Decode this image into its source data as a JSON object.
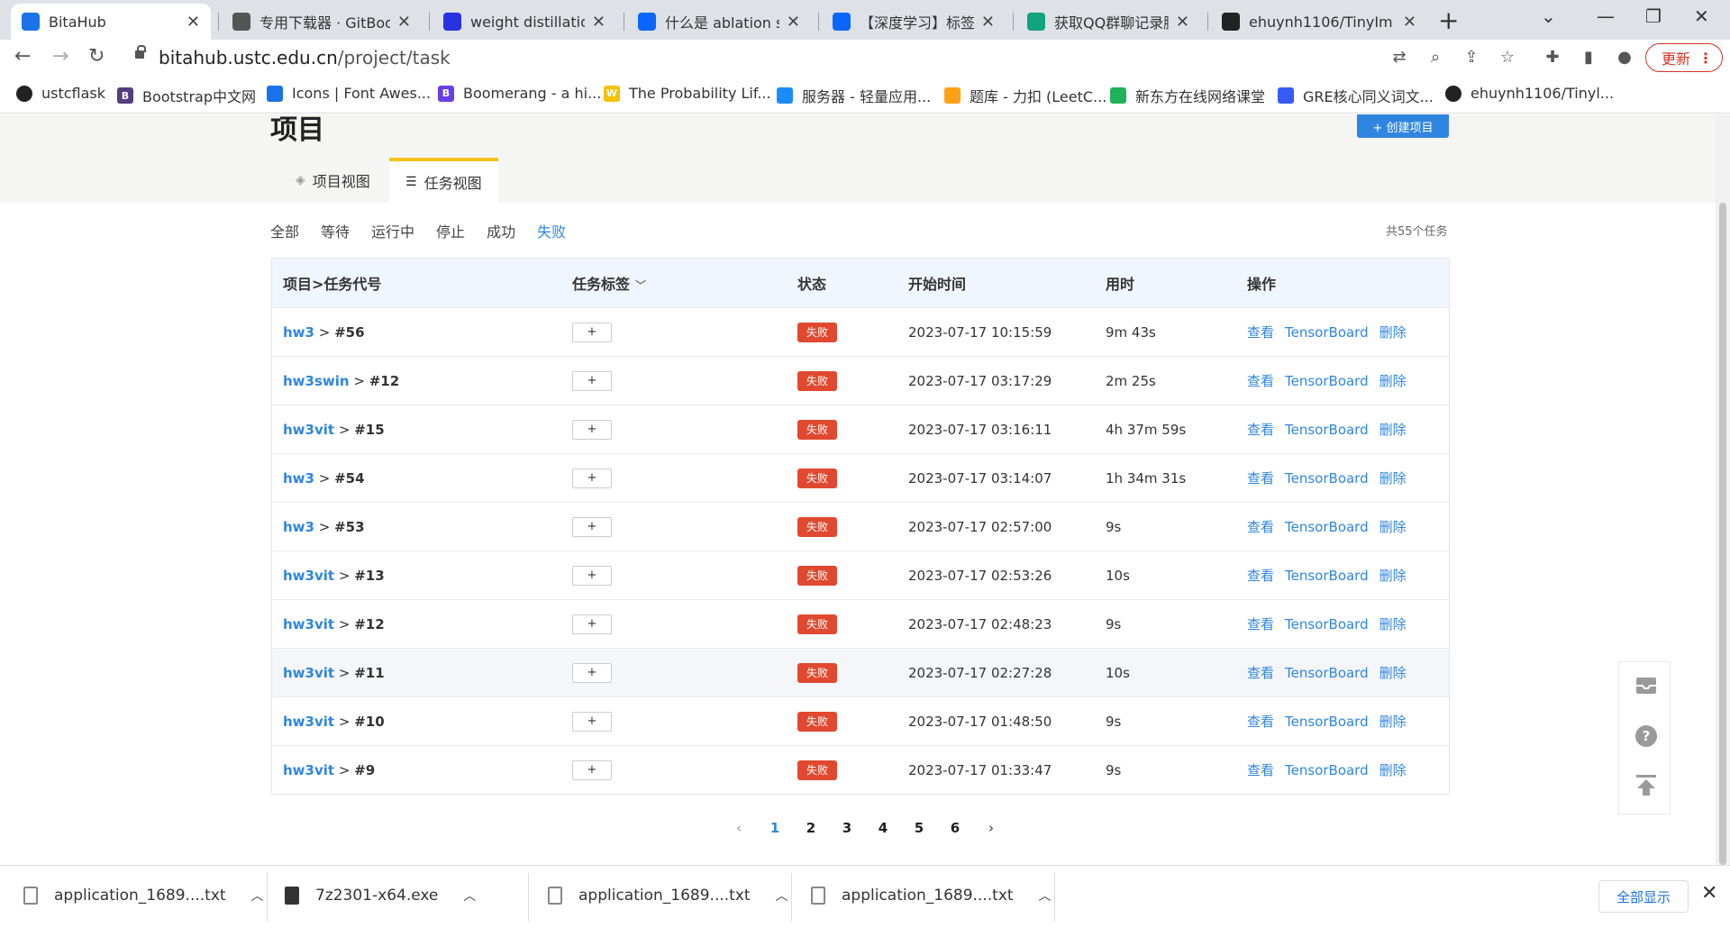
{
  "browser": {
    "tabs": [
      {
        "title": "BitaHub",
        "icon": "bitahub-icon",
        "color": "#1a73e8"
      },
      {
        "title": "专用下载器 · GitBook",
        "icon": "book-icon",
        "color": "#555555"
      },
      {
        "title": "weight distillation_",
        "icon": "baidu-paw-icon",
        "color": "#2932e1"
      },
      {
        "title": "什么是 ablation stud",
        "icon": "zhihu-icon",
        "color": "#0a66ff"
      },
      {
        "title": "【深度学习】标签平",
        "icon": "zhihu-icon",
        "color": "#0a66ff"
      },
      {
        "title": "获取QQ群聊记录脚本",
        "icon": "chatgpt-icon",
        "color": "#10a37f"
      },
      {
        "title": "ehuynh1106/TinyIm",
        "icon": "github-icon",
        "color": "#222222"
      }
    ],
    "url_host": "bitahub.ustc.edu.cn",
    "url_path": "/project/task",
    "update_label": "更新",
    "bookmarks": [
      {
        "title": "ustcflask",
        "icon": "github-icon",
        "color": "#222222",
        "glyph": ""
      },
      {
        "title": "Bootstrap中文网",
        "icon": "bootstrap-icon",
        "color": "#563d7c",
        "glyph": "B"
      },
      {
        "title": "Icons | Font Awes...",
        "icon": "flag-icon",
        "color": "#1a73e8",
        "glyph": ""
      },
      {
        "title": "Boomerang - a hi...",
        "icon": "boomerang-icon",
        "color": "#6a3de8",
        "glyph": "B"
      },
      {
        "title": "The Probability Lif...",
        "icon": "w-icon",
        "color": "#f2c200",
        "glyph": "W"
      },
      {
        "title": "服务器 - 轻量应用...",
        "icon": "cloud-icon",
        "color": "#1a8cff",
        "glyph": ""
      },
      {
        "title": "题库 - 力扣 (LeetC...",
        "icon": "leetcode-icon",
        "color": "#ffa116",
        "glyph": ""
      },
      {
        "title": "新东方在线网络课堂",
        "icon": "koolearn-icon",
        "color": "#1fb25a",
        "glyph": ""
      },
      {
        "title": "GRE核心同义词文...",
        "icon": "search-q-icon",
        "color": "#3a5af4",
        "glyph": ""
      },
      {
        "title": "ehuynh1106/Tinyl...",
        "icon": "github-icon",
        "color": "#222222",
        "glyph": ""
      }
    ]
  },
  "page": {
    "title": "项目",
    "create_label": "+ 创建项目",
    "view_tabs": [
      {
        "label": "项目视图"
      },
      {
        "label": "任务视图"
      }
    ],
    "filters": [
      "全部",
      "等待",
      "运行中",
      "停止",
      "成功",
      "失败"
    ],
    "active_filter": "失败",
    "total_label": "共55个任务"
  },
  "table": {
    "headers": {
      "task": "项目>任务代号",
      "tags": "任务标签",
      "status": "状态",
      "start": "开始时间",
      "duration": "用时",
      "ops": "操作"
    },
    "plus_label": "+",
    "op_labels": {
      "view": "查看",
      "tensorboard": "TensorBoard",
      "delete": "删除"
    },
    "status_colors": {
      "failed": "#e0492f"
    },
    "rows": [
      {
        "project": "hw3",
        "sep": " > ",
        "id": "#56",
        "status": "失败",
        "start": "2023-07-17 10:15:59",
        "duration": "9m 43s"
      },
      {
        "project": "hw3swin",
        "sep": " > ",
        "id": "#12",
        "status": "失败",
        "start": "2023-07-17 03:17:29",
        "duration": "2m 25s"
      },
      {
        "project": "hw3vit",
        "sep": " > ",
        "id": "#15",
        "status": "失败",
        "start": "2023-07-17 03:16:11",
        "duration": "4h 37m 59s"
      },
      {
        "project": "hw3",
        "sep": " > ",
        "id": "#54",
        "status": "失败",
        "start": "2023-07-17 03:14:07",
        "duration": "1h 34m 31s"
      },
      {
        "project": "hw3",
        "sep": " > ",
        "id": "#53",
        "status": "失败",
        "start": "2023-07-17 02:57:00",
        "duration": "9s"
      },
      {
        "project": "hw3vit",
        "sep": " > ",
        "id": "#13",
        "status": "失败",
        "start": "2023-07-17 02:53:26",
        "duration": "10s"
      },
      {
        "project": "hw3vit",
        "sep": " > ",
        "id": "#12",
        "status": "失败",
        "start": "2023-07-17 02:48:23",
        "duration": "9s"
      },
      {
        "project": "hw3vit",
        "sep": " > ",
        "id": "#11",
        "status": "失败",
        "start": "2023-07-17 02:27:28",
        "duration": "10s"
      },
      {
        "project": "hw3vit",
        "sep": " > ",
        "id": "#10",
        "status": "失败",
        "start": "2023-07-17 01:48:50",
        "duration": "9s"
      },
      {
        "project": "hw3vit",
        "sep": " > ",
        "id": "#9",
        "status": "失败",
        "start": "2023-07-17 01:33:47",
        "duration": "9s"
      }
    ]
  },
  "pagination": {
    "pages": [
      "1",
      "2",
      "3",
      "4",
      "5",
      "6"
    ],
    "current": "1"
  },
  "downloads": {
    "items": [
      {
        "name": "application_1689....txt",
        "type": "txt"
      },
      {
        "name": "7z2301-x64.exe",
        "type": "exe"
      },
      {
        "name": "application_1689....txt",
        "type": "txt"
      },
      {
        "name": "application_1689....txt",
        "type": "txt"
      }
    ],
    "show_all_label": "全部显示"
  }
}
